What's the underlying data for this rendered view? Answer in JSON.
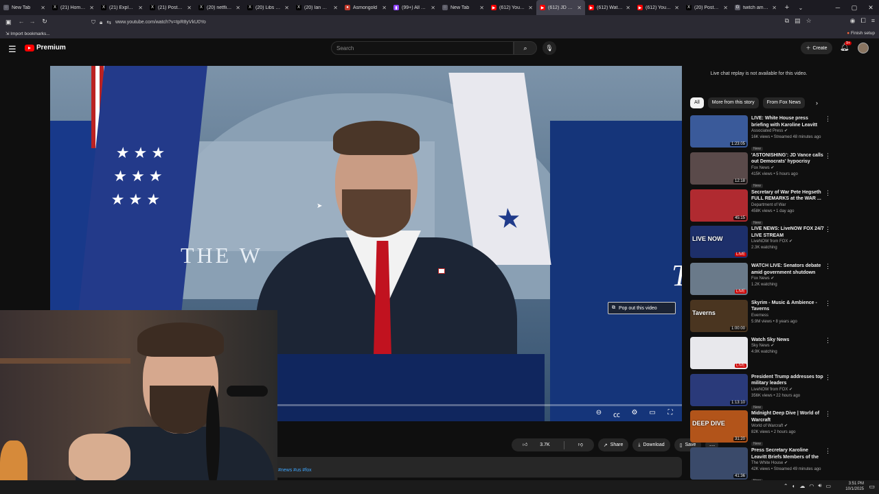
{
  "browser": {
    "tabs": [
      {
        "title": "New Tab",
        "color": "#5b5b66",
        "glyph": "◌"
      },
      {
        "title": "(21) Home / X",
        "color": "#000000",
        "glyph": "X"
      },
      {
        "title": "(21) Explore / X",
        "color": "#000000",
        "glyph": "X"
      },
      {
        "title": "(21) Posts liked",
        "color": "#000000",
        "glyph": "X"
      },
      {
        "title": "(20) netflix - Se",
        "color": "#000000",
        "glyph": "X"
      },
      {
        "title": "(20) Libs of TikT",
        "color": "#000000",
        "glyph": "X"
      },
      {
        "title": "(20) Ian Miles C",
        "color": "#000000",
        "glyph": "X"
      },
      {
        "title": "Asmongold",
        "color": "#c0392b",
        "glyph": "●"
      },
      {
        "title": "(99+) All Categ",
        "color": "#9146ff",
        "glyph": "▮"
      },
      {
        "title": "New Tab",
        "color": "#5b5b66",
        "glyph": "◌"
      },
      {
        "title": "(612) YouTube",
        "color": "#ff0000",
        "glyph": "▶"
      },
      {
        "title": "(612) JD Vance",
        "color": "#ff0000",
        "glyph": "▶",
        "active": true
      },
      {
        "title": "(612) Watch las",
        "color": "#ff0000",
        "glyph": "▶"
      },
      {
        "title": "(612) YouTube",
        "color": "#ff0000",
        "glyph": "▶"
      },
      {
        "title": "(20) Posts liked",
        "color": "#000000",
        "glyph": "X"
      },
      {
        "title": "twitch amazon",
        "color": "#5b5b66",
        "glyph": "G"
      }
    ],
    "url": "www.youtube.com/watch?v=tpR8yVkU0Yo",
    "bookmark": "Import bookmarks...",
    "finish_setup": "Finish setup"
  },
  "header": {
    "logo_text": "Premium",
    "search_placeholder": "Search",
    "create_label": "Create",
    "notif_badge": "9+"
  },
  "player": {
    "wall_text": "THE W",
    "wall_letter": "T",
    "popout_label": "Pop out this video",
    "progress_fraction": 0.19
  },
  "actions": {
    "likes": "3.7K",
    "share": "Share",
    "download": "Download",
    "save": "Save"
  },
  "description": {
    "hashtags": "#news #us #fox"
  },
  "sidebar": {
    "chat_note": "Live chat replay is not available for this video.",
    "chips": [
      "All",
      "More from this story",
      "From Fox News"
    ],
    "recommendations": [
      {
        "title": "LIVE: White House press briefing with Karoline Leavitt",
        "channel": "Associated Press ✔",
        "meta": "16K views • Streamed 48 minutes ago",
        "badge": "New",
        "duration": "1:23:05",
        "thumb": "#3a5a9a",
        "label": ""
      },
      {
        "title": "'ASTONISHING': JD Vance calls out Democrats' hypocrisy",
        "channel": "Fox News ✔",
        "meta": "415K views • 5 hours ago",
        "badge": "New",
        "duration": "12:18",
        "thumb": "#5a4a4a",
        "label": ""
      },
      {
        "title": "Secretary of War Pete Hegseth FULL REMARKS at the WAR ...",
        "channel": "Department of War",
        "meta": "458K views • 1 day ago",
        "badge": "New",
        "duration": "45:15",
        "thumb": "#b02a30",
        "label": ""
      },
      {
        "title": "LIVE NEWS: LiveNOW FOX 24/7 LIVE STREAM",
        "channel": "LiveNOW from FOX ✔",
        "meta": "2.3K watching",
        "badge": "",
        "duration": "LIVE",
        "thumb": "#1d2f6a",
        "label": "LIVE NOW"
      },
      {
        "title": "WATCH LIVE: Senators debate amid government shutdown",
        "channel": "Fox News ✔",
        "meta": "1.2K watching",
        "badge": "",
        "duration": "LIVE",
        "thumb": "#6a7a8a",
        "label": ""
      },
      {
        "title": "Skyrim - Music & Ambience - Taverns",
        "channel": "Everness",
        "meta": "5.9M views • 8 years ago",
        "badge": "",
        "duration": "1:00:00",
        "thumb": "#4a3520",
        "label": "Taverns"
      },
      {
        "title": "Watch Sky News",
        "channel": "Sky News ✔",
        "meta": "4.9K watching",
        "badge": "",
        "duration": "LIVE",
        "thumb": "#e8e8ec",
        "label": ""
      },
      {
        "title": "President Trump addresses top military leaders",
        "channel": "LiveNOW from FOX ✔",
        "meta": "356K views • 22 hours ago",
        "badge": "New",
        "duration": "1:13:10",
        "thumb": "#2a3a7a",
        "label": ""
      },
      {
        "title": "Midnight Deep Dive | World of Warcraft",
        "channel": "World of Warcraft ✔",
        "meta": "82K views • 2 hours ago",
        "badge": "New",
        "duration": "31:20",
        "thumb": "#b2541a",
        "label": "DEEP DIVE"
      },
      {
        "title": "Press Secretary Karoline Leavitt Briefs Members of the Media, ...",
        "channel": "The White House ✔",
        "meta": "42K views • Streamed 49 minutes ago",
        "badge": "New",
        "duration": "41:36",
        "thumb": "#3a4a6a",
        "label": ""
      }
    ]
  },
  "taskbar": {
    "time": "3:51 PM",
    "date": "10/1/2025"
  }
}
